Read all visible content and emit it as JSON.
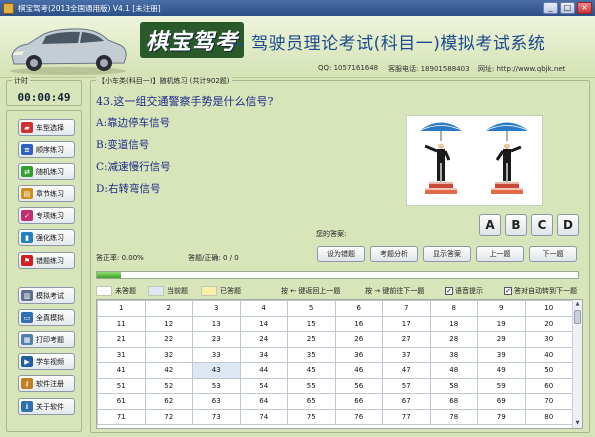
{
  "window": {
    "title": "棋宝驾考(2013全国通用版) V4.1 [未注册]",
    "controls": [
      "_",
      "□",
      "×"
    ]
  },
  "header": {
    "logo": "棋宝驾考",
    "subtitle": "-- 驾驶员理论考试(科目一)模拟考试系统",
    "qq": "QQ: 1057161648",
    "phone": "客服电话: 18901588403",
    "website": "网址: http://www.qbjk.net"
  },
  "timer": {
    "label": "计时",
    "value": "00:00:49"
  },
  "sidebar": {
    "items": [
      {
        "label": "车型选择",
        "icon": "car-icon",
        "color": "#d03030"
      },
      {
        "label": "顺序练习",
        "icon": "list-icon",
        "color": "#3060c0"
      },
      {
        "label": "随机练习",
        "icon": "shuffle-icon",
        "color": "#30a030"
      },
      {
        "label": "章节练习",
        "icon": "book-icon",
        "color": "#d09020"
      },
      {
        "label": "专项练习",
        "icon": "check-icon",
        "color": "#c03070"
      },
      {
        "label": "强化练习",
        "icon": "chart-icon",
        "color": "#2080c0"
      },
      {
        "label": "错题练习",
        "icon": "flag-icon",
        "color": "#d02020"
      },
      {
        "label": "模拟考试",
        "icon": "clipboard-icon",
        "color": "#607090"
      },
      {
        "label": "全真模拟",
        "icon": "monitor-icon",
        "color": "#3070b0"
      },
      {
        "label": "打印考题",
        "icon": "printer-icon",
        "color": "#5080b0"
      },
      {
        "label": "学车视频",
        "icon": "video-icon",
        "color": "#2060a0"
      },
      {
        "label": "软件注册",
        "icon": "key-icon",
        "color": "#c08020"
      },
      {
        "label": "关于软件",
        "icon": "info-icon",
        "color": "#3070b0"
      }
    ]
  },
  "question": {
    "mode": "【小车类(科目一)】随机练习 (共计902题)",
    "text": "43.这一组交通警察手势是什么信号?",
    "options": [
      "A:靠边停车信号",
      "B:变道信号",
      "C:减速慢行信号",
      "D:右转弯信号"
    ],
    "image_icon": "traffic-police-gesture-image"
  },
  "answer": {
    "label": "您的答案:",
    "choices": [
      "A",
      "B",
      "C",
      "D"
    ]
  },
  "stats": {
    "accuracy": "答正率: 0.00%",
    "count": "答题/正确: 0 / 0"
  },
  "actions": [
    "设为错题",
    "考题分析",
    "显示答案",
    "上一题",
    "下一题"
  ],
  "progress": {
    "fraction": 0.05
  },
  "legend": {
    "unanswered": "未答题",
    "current": "当前题",
    "answered": "已答题",
    "key_prev": "按 ← 键返回上一题",
    "key_next": "按 → 键前往下一题",
    "voice": "语音提示",
    "autonext": "答对自动转到下一题",
    "colors": {
      "unanswered": "#ffffff",
      "current": "#dde8f4",
      "answered": "#f8f0a8"
    }
  },
  "grid": {
    "rows": [
      [
        "1",
        "2",
        "3",
        "4",
        "5",
        "6",
        "7",
        "8",
        "9",
        "10"
      ],
      [
        "11",
        "12",
        "13",
        "14",
        "15",
        "16",
        "17",
        "18",
        "19",
        "20"
      ],
      [
        "21",
        "22",
        "23",
        "24",
        "25",
        "26",
        "27",
        "28",
        "29",
        "30"
      ],
      [
        "31",
        "32",
        "33",
        "34",
        "35",
        "36",
        "37",
        "38",
        "39",
        "40"
      ],
      [
        "41",
        "42",
        "43",
        "44",
        "45",
        "46",
        "47",
        "48",
        "49",
        "50"
      ],
      [
        "51",
        "52",
        "53",
        "54",
        "55",
        "56",
        "57",
        "58",
        "59",
        "60"
      ],
      [
        "61",
        "62",
        "63",
        "64",
        "65",
        "66",
        "67",
        "68",
        "69",
        "70"
      ],
      [
        "71",
        "72",
        "73",
        "74",
        "75",
        "76",
        "77",
        "78",
        "79",
        "80"
      ]
    ],
    "current": "43"
  }
}
